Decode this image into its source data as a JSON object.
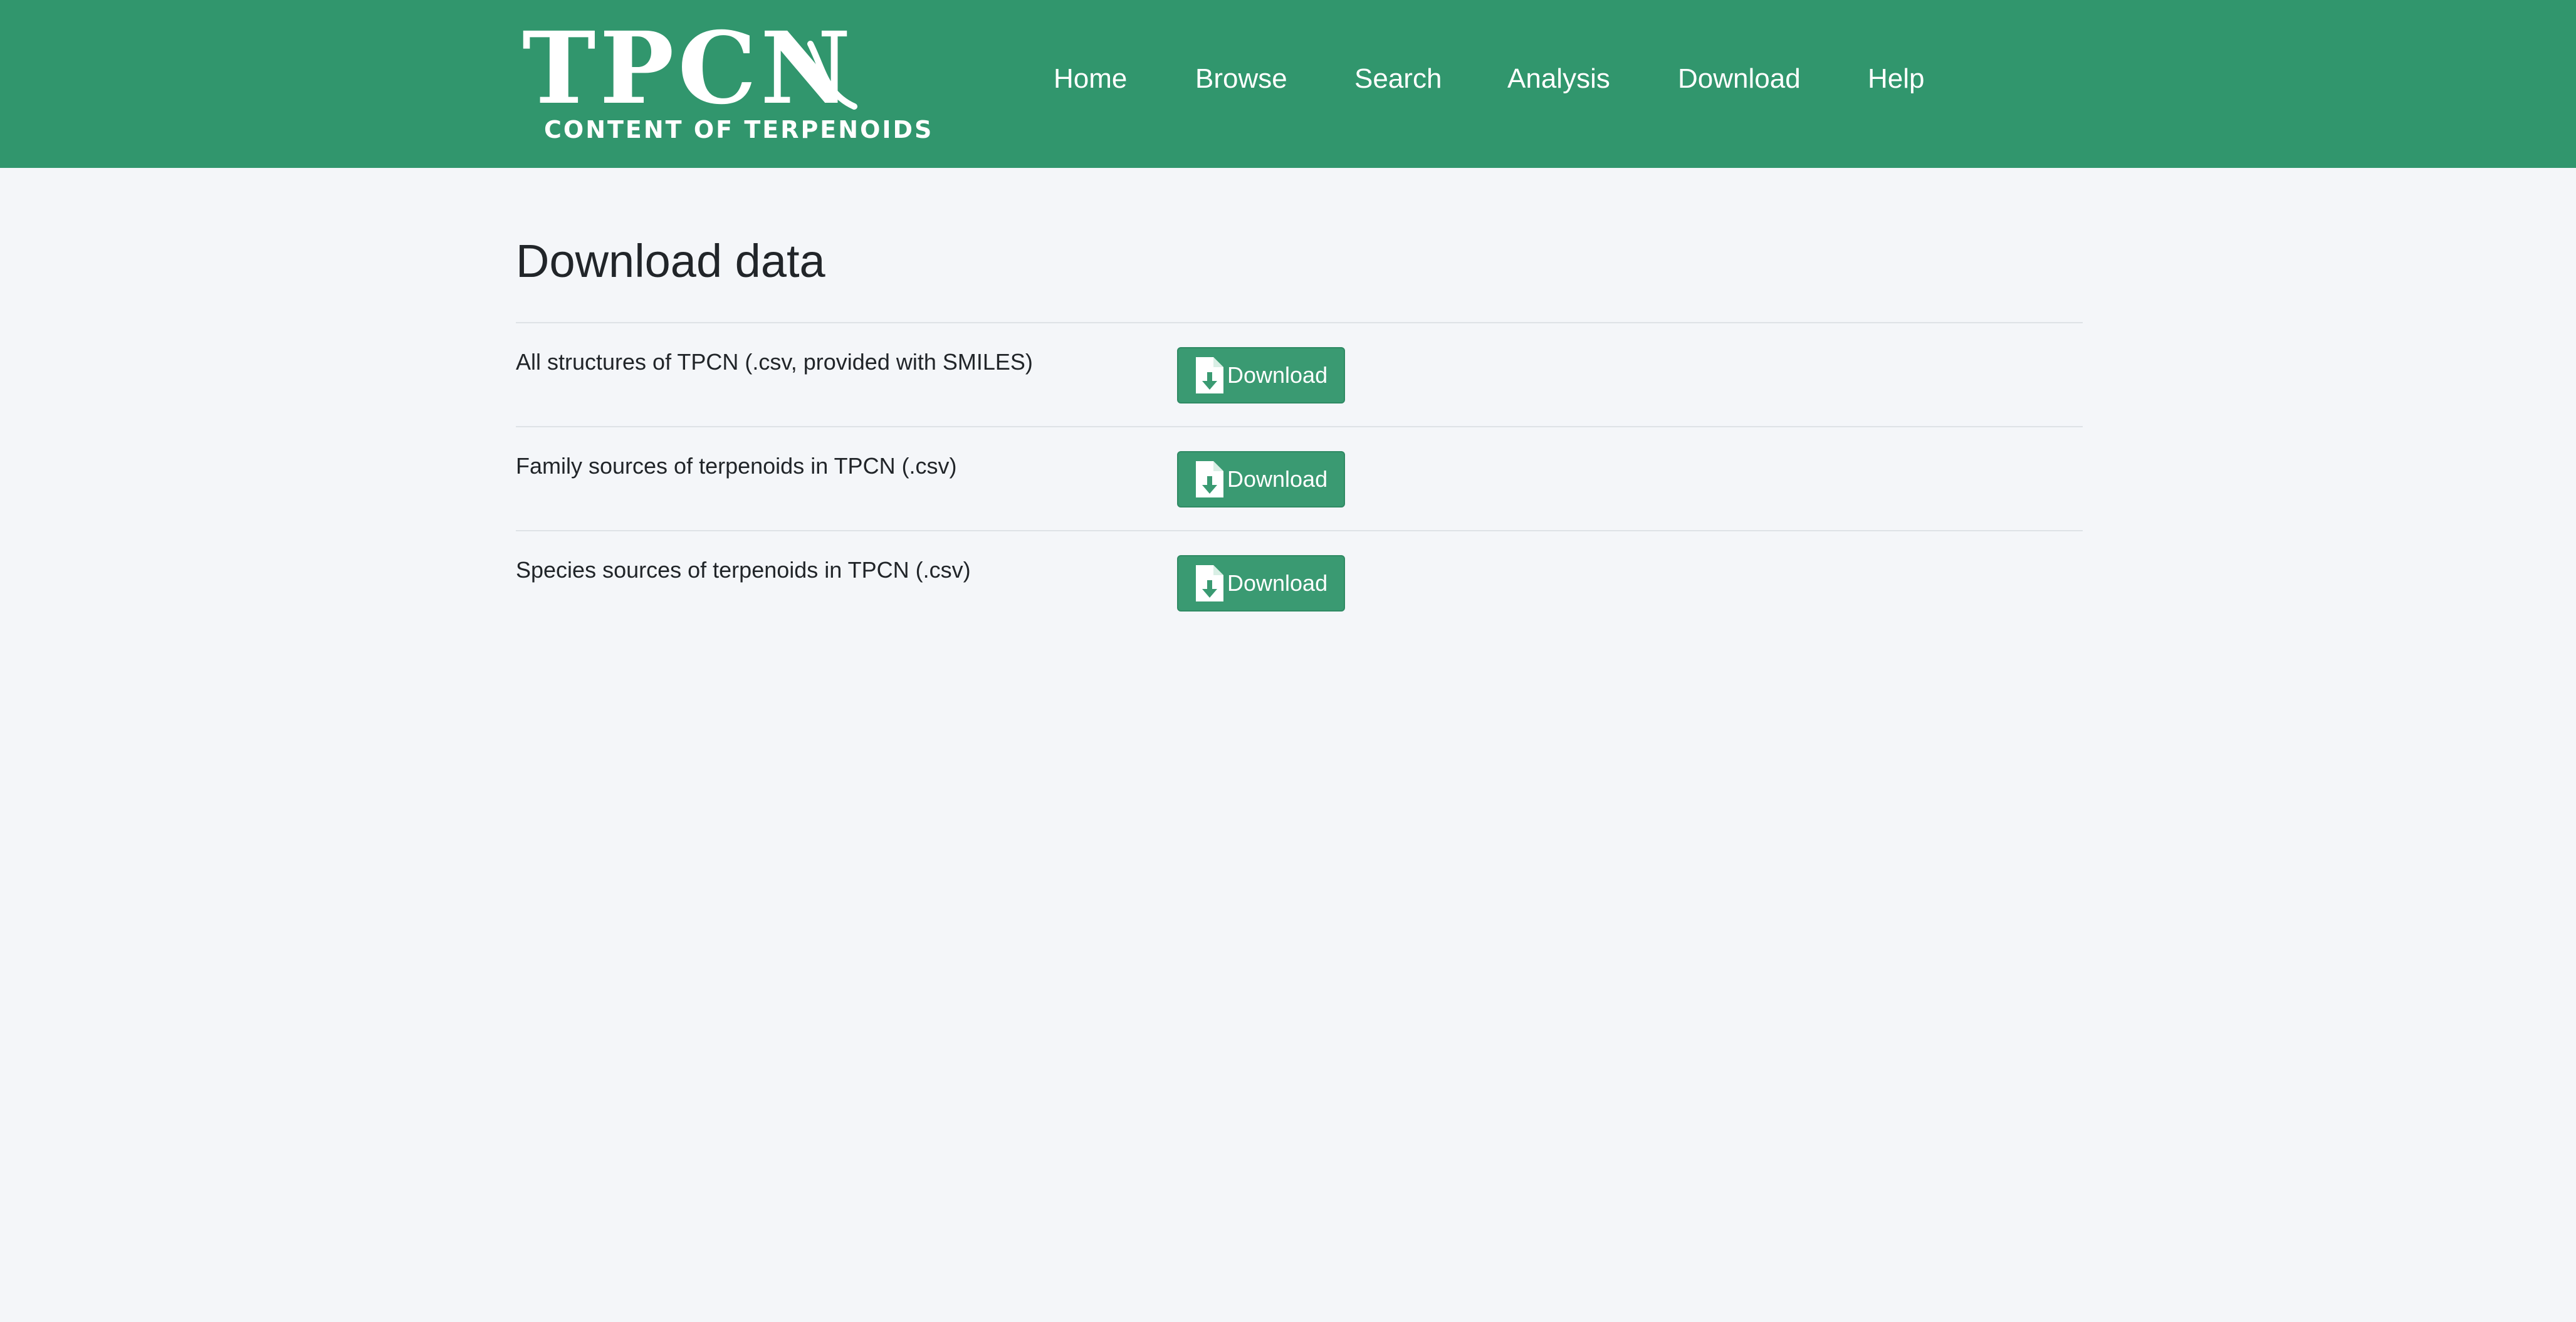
{
  "header": {
    "logo_title": "TPCN",
    "logo_subtitle": "CONTENT OF TERPENOIDS",
    "nav": [
      {
        "label": "Home"
      },
      {
        "label": "Browse"
      },
      {
        "label": "Search"
      },
      {
        "label": "Analysis"
      },
      {
        "label": "Download"
      },
      {
        "label": "Help"
      }
    ]
  },
  "main": {
    "title": "Download data",
    "rows": [
      {
        "label": "All structures of TPCN (.csv, provided with SMILES)",
        "button_label": "Download",
        "icon": "file-download-icon"
      },
      {
        "label": "Family sources of terpenoids in TPCN (.csv)",
        "button_label": "Download",
        "icon": "file-download-icon"
      },
      {
        "label": "Species sources of terpenoids in TPCN (.csv)",
        "button_label": "Download",
        "icon": "file-download-icon"
      }
    ]
  },
  "colors": {
    "brand": "#31966d",
    "button": "#3a9a72",
    "background": "#f4f6f9",
    "text": "#212529"
  }
}
